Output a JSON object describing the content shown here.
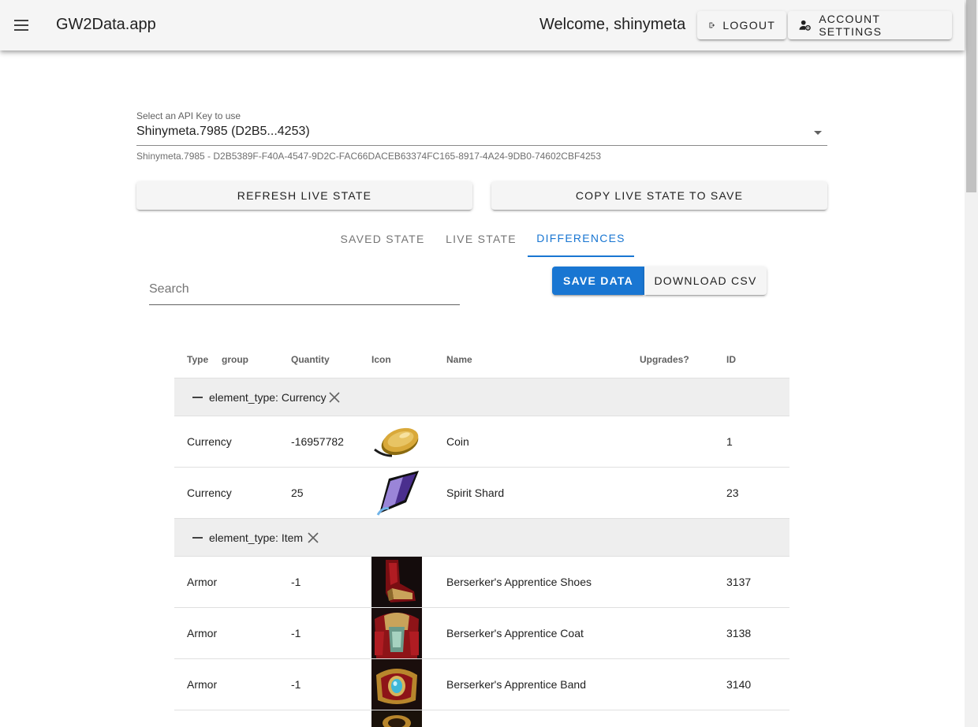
{
  "app": {
    "title": "GW2Data.app",
    "welcome": "Welcome, shinymeta"
  },
  "header": {
    "logout_label": "LOGOUT",
    "settings_label": "ACCOUNT SETTINGS"
  },
  "api_key": {
    "label": "Select an API Key to use",
    "value": "Shinymeta.7985 (D2B5...4253)",
    "hint": "Shinymeta.7985 - D2B5389F-F40A-4547-9D2C-FAC66DACEB63374FC165-8917-4A24-9DB0-74602CBF4253"
  },
  "actions": {
    "refresh_label": "REFRESH LIVE STATE",
    "copy_label": "COPY LIVE STATE TO SAVE"
  },
  "tabs": [
    {
      "label": "SAVED STATE",
      "active": false
    },
    {
      "label": "LIVE STATE",
      "active": false
    },
    {
      "label": "DIFFERENCES",
      "active": true
    }
  ],
  "search": {
    "placeholder": "Search",
    "value": ""
  },
  "toolbar": {
    "save_label": "SAVE DATA",
    "csv_label": "DOWNLOAD CSV"
  },
  "table": {
    "headers": {
      "type": "Type",
      "group": "group",
      "quantity": "Quantity",
      "icon": "Icon",
      "name": "Name",
      "upgrades": "Upgrades?",
      "id": "ID"
    },
    "groups": [
      {
        "label": "element_type: Currency",
        "rows": [
          {
            "type": "Currency",
            "quantity": "-16957782",
            "icon": "coin-icon",
            "name": "Coin",
            "id": "1"
          },
          {
            "type": "Currency",
            "quantity": "25",
            "icon": "spirit-shard-icon",
            "name": "Spirit Shard",
            "id": "23"
          }
        ]
      },
      {
        "label": "element_type: Item",
        "rows": [
          {
            "type": "Armor",
            "quantity": "-1",
            "icon": "shoes-icon",
            "name": "Berserker's Apprentice Shoes",
            "id": "3137"
          },
          {
            "type": "Armor",
            "quantity": "-1",
            "icon": "coat-icon",
            "name": "Berserker's Apprentice Coat",
            "id": "3138"
          },
          {
            "type": "Armor",
            "quantity": "-1",
            "icon": "band-icon",
            "name": "Berserker's Apprentice Band",
            "id": "3140"
          }
        ]
      }
    ]
  },
  "colors": {
    "primary": "#1976d2",
    "appbar": "#f5f5f5",
    "group_bg": "#eeeeee"
  }
}
